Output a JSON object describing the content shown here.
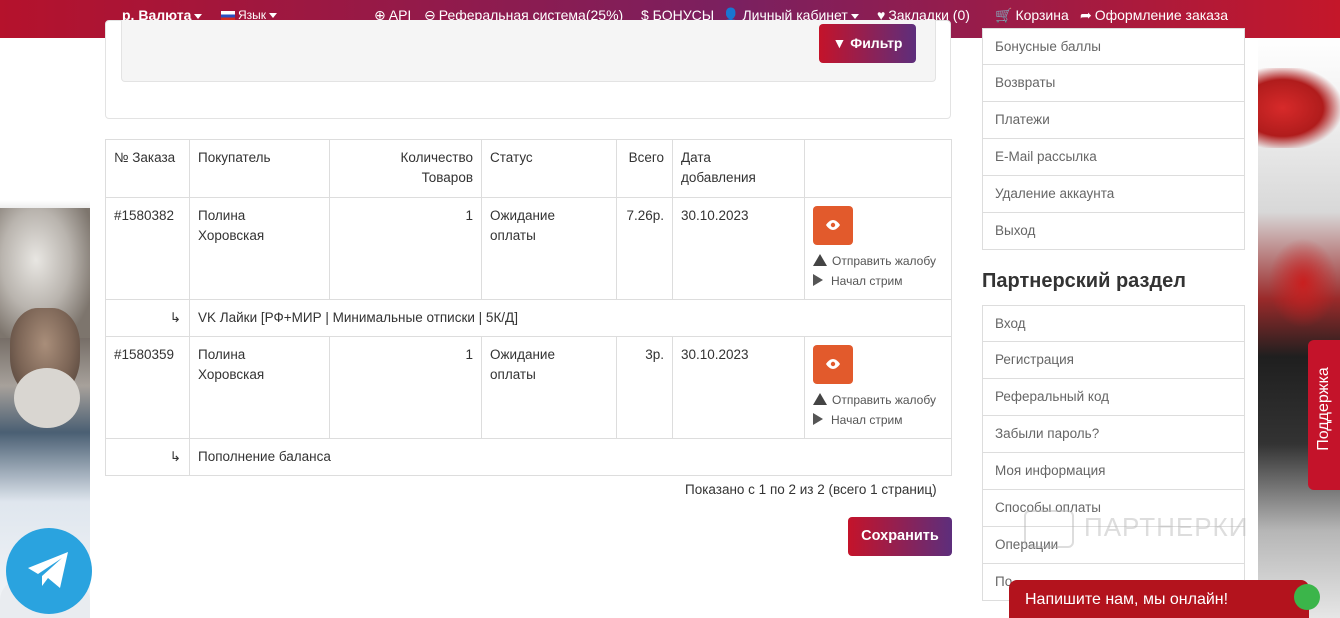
{
  "topbar": {
    "currency": "р. Валюта",
    "language": "Язык",
    "api": "API",
    "referral": "Реферальная система(25%)",
    "bonuses": "$ БОНУСЫ",
    "account": "Личный кабинет",
    "bookmarks": "Закладки (0)",
    "cart": "Корзина",
    "checkout": "Оформление заказа"
  },
  "filter": {
    "button": "Фильтр"
  },
  "table": {
    "headers": {
      "order_no": "№ Заказа",
      "buyer": "Покупатель",
      "qty_line1": "Количество",
      "qty_line2": "Товаров",
      "status": "Статус",
      "total": "Всего",
      "date_line1": "Дата",
      "date_line2": "добавления"
    },
    "rows": [
      {
        "order": "#1580382",
        "buyer_line1": "Полина",
        "buyer_line2": "Хоровская",
        "qty": "1",
        "status_line1": "Ожидание",
        "status_line2": "оплаты",
        "total": "7.26р.",
        "date": "30.10.2023",
        "complaint": "Отправить жалобу",
        "stream": "Начал стрим",
        "subitem": "VK Лайки [РФ+МИР | Минимальные отписки | 5К/Д]"
      },
      {
        "order": "#1580359",
        "buyer_line1": "Полина",
        "buyer_line2": "Хоровская",
        "qty": "1",
        "status_line1": "Ожидание",
        "status_line2": "оплаты",
        "total": "3р.",
        "date": "30.10.2023",
        "complaint": "Отправить жалобу",
        "stream": "Начал стрим",
        "subitem": "Пополнение баланса"
      }
    ],
    "sub_arrow": "↳"
  },
  "pagination": {
    "info": "Показано с 1 по 2 из 2 (всего 1 страниц)"
  },
  "save_button": "Сохранить",
  "sidebar": {
    "account_items": [
      "Бонусные баллы",
      "Возвраты",
      "Платежи",
      "E-Mail рассылка",
      "Удаление аккаунта",
      "Выход"
    ],
    "partner_heading": "Партнерский раздел",
    "partner_items": [
      "Вход",
      "Регистрация",
      "Реферальный код",
      "Забыли пароль?",
      "Моя информация",
      "Способы оплаты",
      "Операции",
      "По..."
    ]
  },
  "support_tab": "Поддержка",
  "chat_widget": "Напишите нам, мы онлайн!",
  "watermark": "ПАРТНЕРКИ",
  "colors": {
    "accent_red": "#c4132a",
    "accent_purple": "#5d2e7c",
    "view_button": "#e25a2c",
    "telegram": "#2aa3df"
  }
}
